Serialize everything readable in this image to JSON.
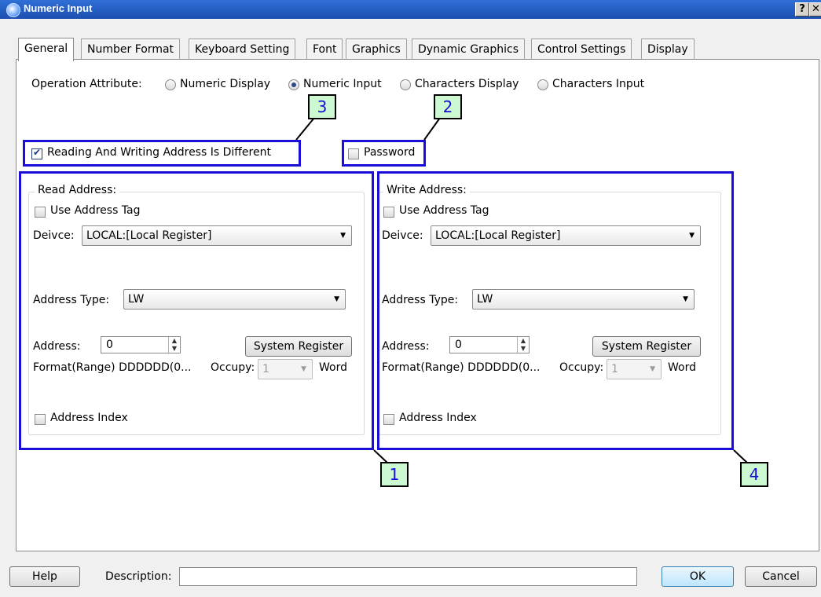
{
  "window": {
    "title": "Numeric Input",
    "help_btn": "?",
    "close_btn": "✕"
  },
  "tabs": [
    "General",
    "Number Format",
    "Keyboard Setting",
    "Font",
    "Graphics",
    "Dynamic Graphics",
    "Control Settings",
    "Display"
  ],
  "active_tab": "General",
  "operation": {
    "label": "Operation Attribute:",
    "options": [
      "Numeric Display",
      "Numeric Input",
      "Characters Display",
      "Characters Input"
    ],
    "selected": "Numeric Input"
  },
  "rw_different": {
    "label": "Reading And Writing Address Is Different",
    "checked": true
  },
  "password": {
    "label": "Password",
    "checked": false
  },
  "read": {
    "title": "Read Address:",
    "use_tag": "Use Address Tag",
    "device_label": "Deivce:",
    "device_value": "LOCAL:[Local Register]",
    "type_label": "Address Type:",
    "type_value": "LW",
    "address_label": "Address:",
    "address_value": "0",
    "sysreg": "System Register",
    "format": "Format(Range) DDDDDD(0...",
    "occupy_label": "Occupy:",
    "occupy_value": "1",
    "word": "Word",
    "index": "Address Index"
  },
  "write": {
    "title": "Write Address:",
    "use_tag": "Use Address Tag",
    "device_label": "Deivce:",
    "device_value": "LOCAL:[Local Register]",
    "type_label": "Address Type:",
    "type_value": "LW",
    "address_label": "Address:",
    "address_value": "0",
    "sysreg": "System Register",
    "format": "Format(Range) DDDDDD(0...",
    "occupy_label": "Occupy:",
    "occupy_value": "1",
    "word": "Word",
    "index": "Address Index"
  },
  "callouts": [
    "1",
    "2",
    "3",
    "4"
  ],
  "bottom": {
    "help": "Help",
    "description_label": "Description:",
    "description_value": "",
    "ok": "OK",
    "cancel": "Cancel"
  },
  "colors": {
    "annotation_blue": "#1a0ed8",
    "callout_fill": "#ccf9d2",
    "titlebar": "#2f6fd6"
  }
}
